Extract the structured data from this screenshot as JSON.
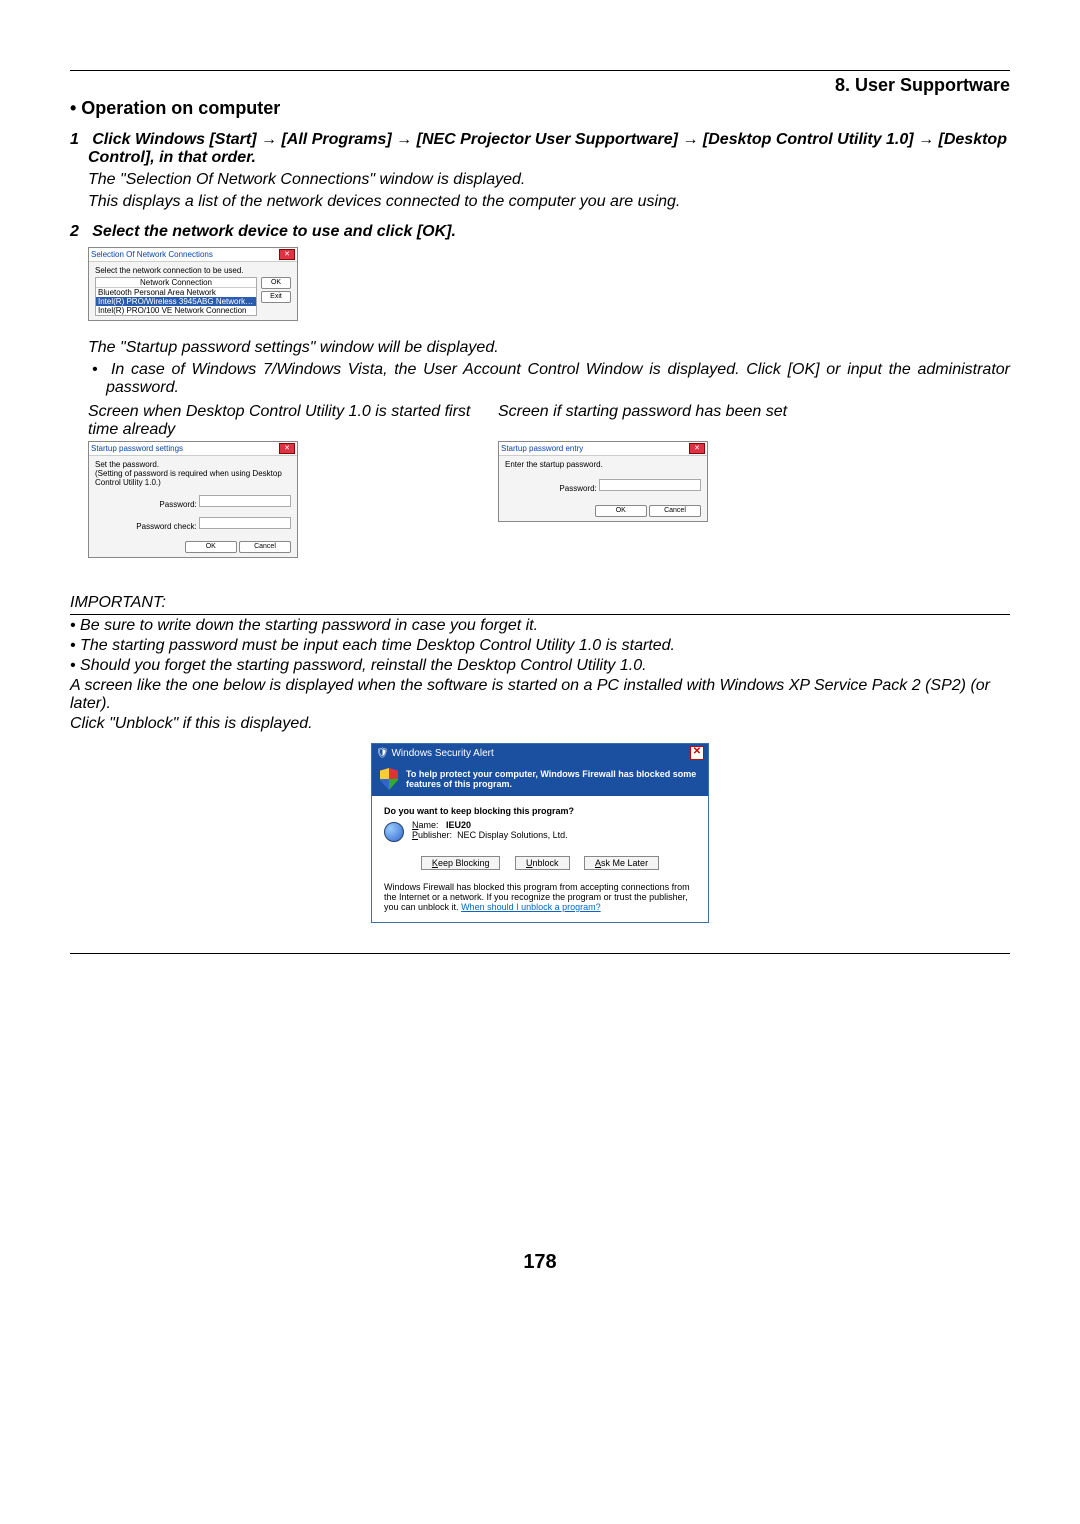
{
  "chapter": "8. User Supportware",
  "section": "• Operation on computer",
  "step1_prefix": "1",
  "step1_parts": {
    "a": "Click Windows [Start]",
    "b": "[All Programs]",
    "c": "[NEC Projector User Supportware]",
    "d": "[Desktop Control Utility 1.0]",
    "e": "[Desktop Control], in that order."
  },
  "step1_note1": "The \"Selection Of Network Connections\" window is displayed.",
  "step1_note2": "This displays a list of the network devices connected to the computer you are using.",
  "step2_prefix": "2",
  "step2_text": "Select the network device to use and click [OK].",
  "dlg_net": {
    "title": "Selection Of Network Connections",
    "prompt": "Select the network connection to be used.",
    "col": "Network Connection",
    "rows": [
      "Bluetooth Personal Area Network",
      "Intel(R) PRO/Wireless 3945ABG Network…",
      "Intel(R) PRO/100 VE Network Connection"
    ],
    "ok": "OK",
    "exit": "Exit"
  },
  "step2_after": "The \"Startup password settings\" window will be displayed.",
  "note_uac": "In case of Windows 7/Windows Vista, the User Account Control Window is displayed. Click [OK] or input the administrator password.",
  "caption_left": "Screen when Desktop Control Utility 1.0 is started first time already",
  "caption_right": "Screen if starting password has been set",
  "dlg_set": {
    "title": "Startup password settings",
    "line1": "Set the password.",
    "line2": "(Setting of password is required when using Desktop Control Utility 1.0.)",
    "pw": "Password:",
    "pwc": "Password check:",
    "ok": "OK",
    "cancel": "Cancel"
  },
  "dlg_entry": {
    "title": "Startup password entry",
    "prompt": "Enter the startup password.",
    "pw": "Password:",
    "ok": "OK",
    "cancel": "Cancel"
  },
  "important": "IMPORTANT:",
  "imp1": "Be sure to write down the starting password in case you forget it.",
  "imp2": "The starting password must be input each time Desktop Control Utility 1.0 is started.",
  "imp3": "Should you forget the starting password, reinstall the Desktop Control Utility 1.0.",
  "sp2_para": "A screen like the one below is displayed when the software is started on a PC installed with Windows XP Service Pack 2 (SP2) (or later).",
  "unblock_line": "Click \"Unblock\" if this is displayed.",
  "alert": {
    "title": "Windows Security Alert",
    "banner": "To help protect your computer, Windows Firewall has blocked some features of this program.",
    "question": "Do you want to keep blocking this program?",
    "name_label": "Name:",
    "name_val": "IEU20",
    "pub_label": "Publisher:",
    "pub_val": "NEC Display Solutions, Ltd.",
    "keep": "Keep Blocking",
    "unblock": "Unblock",
    "later": "Ask Me Later",
    "footer": "Windows Firewall has blocked this program from accepting connections from the Internet or a network. If you recognize the program or trust the publisher, you can unblock it.",
    "link": "When should I unblock a program?"
  },
  "page_number": "178"
}
